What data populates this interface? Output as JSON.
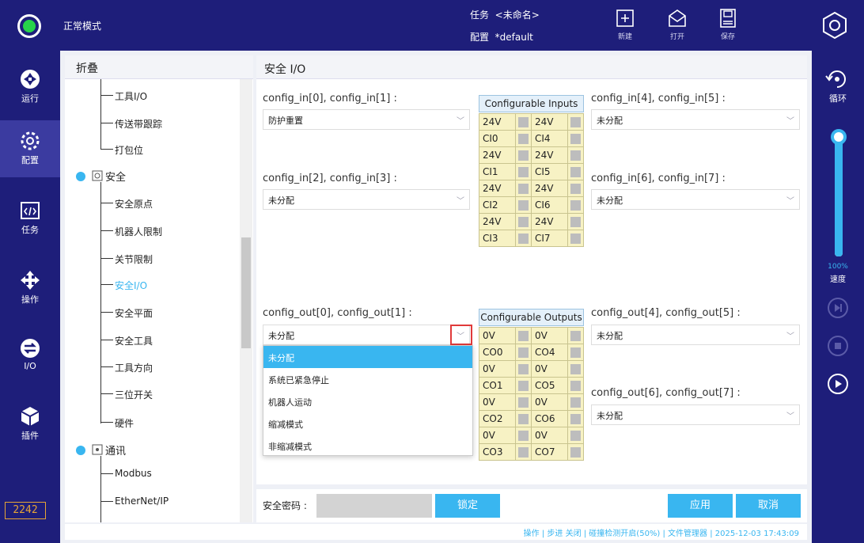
{
  "topbar": {
    "mode": "正常模式",
    "task_label": "任务",
    "task_value": "<未命名>",
    "config_label": "配置",
    "config_value": "*default",
    "btn_new": "新建",
    "btn_open": "打开",
    "btn_save": "保存"
  },
  "leftnav": {
    "items": [
      {
        "label": "运行",
        "icon": "run-icon"
      },
      {
        "label": "配置",
        "icon": "config-icon"
      },
      {
        "label": "任务",
        "icon": "task-icon"
      },
      {
        "label": "操作",
        "icon": "move-icon"
      },
      {
        "label": "I/O",
        "icon": "io-icon"
      },
      {
        "label": "插件",
        "icon": "plugin-icon"
      }
    ],
    "counter": "2242"
  },
  "tree": {
    "header": "折叠",
    "items": [
      "工具I/O",
      "传送带跟踪",
      "打包位",
      "安全",
      "安全原点",
      "机器人限制",
      "关节限制",
      "安全I/O",
      "安全平面",
      "安全工具",
      "工具方向",
      "三位开关",
      "硬件",
      "通讯",
      "Modbus",
      "EtherNet/IP"
    ]
  },
  "main": {
    "title": "安全 I/O",
    "in_labels": [
      "config_in[0], config_in[1] :",
      "config_in[2], config_in[3] :",
      "config_in[4], config_in[5] :",
      "config_in[6], config_in[7] :"
    ],
    "in_values": [
      "防护重置",
      "未分配",
      "未分配",
      "未分配"
    ],
    "out_labels": [
      "config_out[0], config_out[1] :",
      "config_out[4], config_out[5] :",
      "config_out[6], config_out[7] :"
    ],
    "out_values": [
      "未分配",
      "未分配",
      "未分配"
    ],
    "inputs_title": "Configurable Inputs",
    "outputs_title": "Configurable Outputs",
    "inputs_rows": [
      [
        "24V",
        "24V"
      ],
      [
        "CI0",
        "CI4"
      ],
      [
        "24V",
        "24V"
      ],
      [
        "CI1",
        "CI5"
      ],
      [
        "24V",
        "24V"
      ],
      [
        "CI2",
        "CI6"
      ],
      [
        "24V",
        "24V"
      ],
      [
        "CI3",
        "CI7"
      ]
    ],
    "outputs_rows": [
      [
        "0V",
        "0V"
      ],
      [
        "CO0",
        "CO4"
      ],
      [
        "0V",
        "0V"
      ],
      [
        "CO1",
        "CO5"
      ],
      [
        "0V",
        "0V"
      ],
      [
        "CO2",
        "CO6"
      ],
      [
        "0V",
        "0V"
      ],
      [
        "CO3",
        "CO7"
      ]
    ],
    "dropdown_options": [
      "未分配",
      "系统已紧急停止",
      "机器人运动",
      "缩减模式",
      "非缩减模式"
    ]
  },
  "bottom": {
    "password_label": "安全密码 :",
    "lock": "锁定",
    "apply": "应用",
    "cancel": "取消",
    "status": "操作 | 步进 关闭 | 碰撞检测开启(50%) | 文件管理器 | 2025-12-03 17:43:09"
  },
  "rightbar": {
    "loop": "循环",
    "speed_pct": "100%",
    "speed_label": "速度",
    "speed_value": 100
  },
  "colors": {
    "navy": "#1e1e7a",
    "accent": "#39b6f0",
    "status_green": "#27d34a",
    "io_yellow": "#f7f2c4"
  }
}
